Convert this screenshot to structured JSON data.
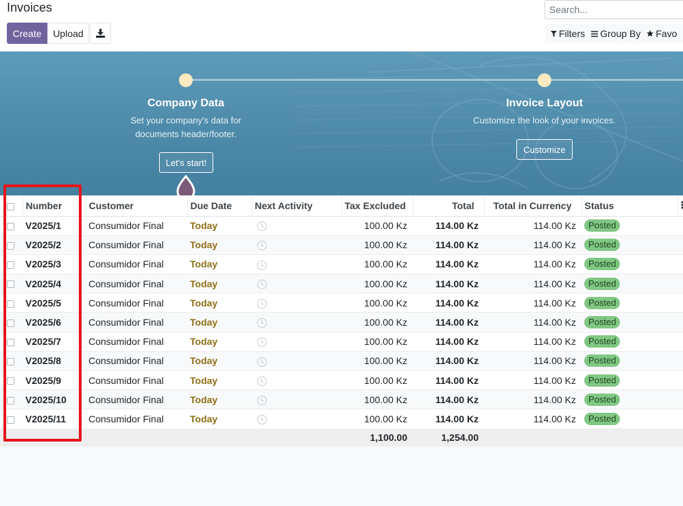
{
  "header": {
    "title": "Invoices",
    "create_label": "Create",
    "upload_label": "Upload",
    "search_placeholder": "Search...",
    "filters_label": "Filters",
    "group_by_label": "Group By",
    "favorites_label": "Favo"
  },
  "banner": {
    "steps": [
      {
        "title": "Company Data",
        "description_line1": "Set your company's data for",
        "description_line2": "documents header/footer.",
        "button": "Let's start!"
      },
      {
        "title": "Invoice Layout",
        "description_line1": "Customize the look of your invoices.",
        "description_line2": "",
        "button": "Customize"
      }
    ]
  },
  "table": {
    "columns": [
      "Number",
      "Customer",
      "Due Date",
      "Next Activity",
      "Tax Excluded",
      "Total",
      "Total in Currency",
      "Status"
    ],
    "rows": [
      {
        "number": "V2025/1",
        "customer": "Consumidor Final",
        "due": "Today",
        "tax_excluded": "100.00 Kz",
        "total": "114.00 Kz",
        "total_currency": "114.00 Kz",
        "status": "Posted"
      },
      {
        "number": "V2025/2",
        "customer": "Consumidor Final",
        "due": "Today",
        "tax_excluded": "100.00 Kz",
        "total": "114.00 Kz",
        "total_currency": "114.00 Kz",
        "status": "Posted"
      },
      {
        "number": "V2025/3",
        "customer": "Consumidor Final",
        "due": "Today",
        "tax_excluded": "100.00 Kz",
        "total": "114.00 Kz",
        "total_currency": "114.00 Kz",
        "status": "Posted"
      },
      {
        "number": "V2025/4",
        "customer": "Consumidor Final",
        "due": "Today",
        "tax_excluded": "100.00 Kz",
        "total": "114.00 Kz",
        "total_currency": "114.00 Kz",
        "status": "Posted"
      },
      {
        "number": "V2025/5",
        "customer": "Consumidor Final",
        "due": "Today",
        "tax_excluded": "100.00 Kz",
        "total": "114.00 Kz",
        "total_currency": "114.00 Kz",
        "status": "Posted"
      },
      {
        "number": "V2025/6",
        "customer": "Consumidor Final",
        "due": "Today",
        "tax_excluded": "100.00 Kz",
        "total": "114.00 Kz",
        "total_currency": "114.00 Kz",
        "status": "Posted"
      },
      {
        "number": "V2025/7",
        "customer": "Consumidor Final",
        "due": "Today",
        "tax_excluded": "100.00 Kz",
        "total": "114.00 Kz",
        "total_currency": "114.00 Kz",
        "status": "Posted"
      },
      {
        "number": "V2025/8",
        "customer": "Consumidor Final",
        "due": "Today",
        "tax_excluded": "100.00 Kz",
        "total": "114.00 Kz",
        "total_currency": "114.00 Kz",
        "status": "Posted"
      },
      {
        "number": "V2025/9",
        "customer": "Consumidor Final",
        "due": "Today",
        "tax_excluded": "100.00 Kz",
        "total": "114.00 Kz",
        "total_currency": "114.00 Kz",
        "status": "Posted"
      },
      {
        "number": "V2025/10",
        "customer": "Consumidor Final",
        "due": "Today",
        "tax_excluded": "100.00 Kz",
        "total": "114.00 Kz",
        "total_currency": "114.00 Kz",
        "status": "Posted"
      },
      {
        "number": "V2025/11",
        "customer": "Consumidor Final",
        "due": "Today",
        "tax_excluded": "100.00 Kz",
        "total": "114.00 Kz",
        "total_currency": "114.00 Kz",
        "status": "Posted"
      }
    ],
    "totals": {
      "tax_excluded": "1,100.00",
      "total": "1,254.00"
    }
  },
  "colors": {
    "primary": "#71639e",
    "today": "#8f6f16",
    "posted_badge": "#81c784",
    "highlight": "#e8141c"
  },
  "icons": {
    "download": "download-icon",
    "filter": "filter-icon",
    "group_by": "list-icon",
    "favorites": "star-icon",
    "activity": "clock-icon",
    "column_options": "vertical-dots-icon"
  }
}
